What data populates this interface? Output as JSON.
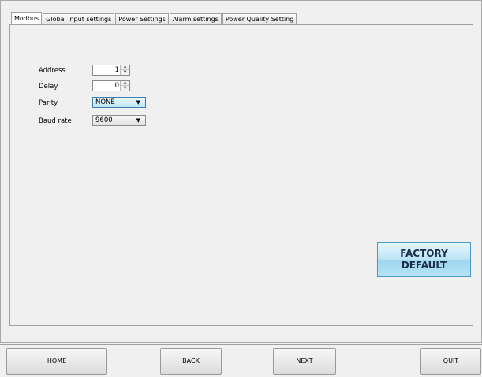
{
  "tabs": [
    {
      "label": "Modbus",
      "active": true
    },
    {
      "label": "Global input settings",
      "active": false
    },
    {
      "label": "Power Settings",
      "active": false
    },
    {
      "label": "Alarm settings",
      "active": false
    },
    {
      "label": "Power Quality Setting",
      "active": false
    }
  ],
  "modbus": {
    "address": {
      "label": "Address",
      "value": "1"
    },
    "delay": {
      "label": "Delay",
      "value": "0"
    },
    "parity": {
      "label": "Parity",
      "value": "NONE"
    },
    "baud_rate": {
      "label": "Baud rate",
      "value": "9600"
    }
  },
  "factory_default": {
    "line1": "FACTORY",
    "line2": "DEFAULT"
  },
  "nav": {
    "home": "HOME",
    "back": "BACK",
    "next": "NEXT",
    "quit": "QUIT"
  },
  "colors": {
    "focus_combo": "#bfe6f7",
    "factory_button": "#b9e4f6",
    "background": "#f0f0f0"
  }
}
